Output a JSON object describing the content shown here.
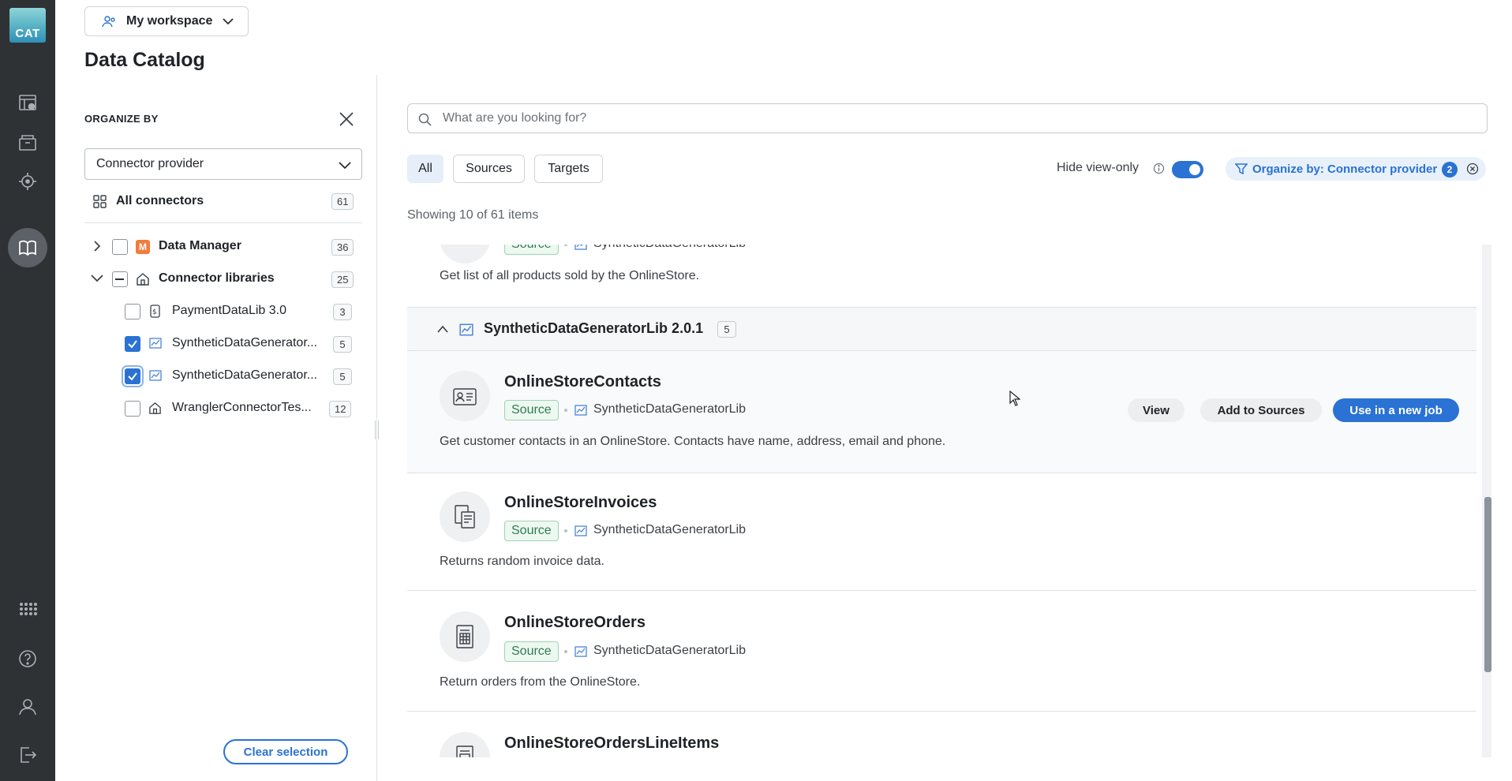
{
  "app": {
    "logo_text": "CAT"
  },
  "rail": {
    "items": [
      {
        "name": "jobs-icon"
      },
      {
        "name": "folder-icon"
      },
      {
        "name": "target-icon"
      },
      {
        "name": "catalog-book-icon",
        "active": true
      }
    ],
    "bottom": [
      {
        "name": "apps-grid-icon"
      },
      {
        "name": "help-icon"
      },
      {
        "name": "user-icon"
      },
      {
        "name": "logout-icon"
      }
    ]
  },
  "header": {
    "workspace": "My workspace",
    "title": "Data Catalog"
  },
  "organize": {
    "title": "ORGANIZE BY",
    "selected": "Connector provider",
    "all_label": "All connectors",
    "all_count": "61",
    "tree": [
      {
        "label": "Data Manager",
        "count": "36",
        "icon": "M"
      },
      {
        "label": "Connector libraries",
        "count": "25"
      },
      {
        "label": "PaymentDataLib 3.0",
        "count": "3"
      },
      {
        "label": "SyntheticDataGenerator...",
        "count": "5"
      },
      {
        "label": "SyntheticDataGenerator...",
        "count": "5"
      },
      {
        "label": "WranglerConnectorTes...",
        "count": "12"
      }
    ],
    "clear_label": "Clear selection"
  },
  "main": {
    "search_placeholder": "What are you looking for?",
    "filters": [
      "All",
      "Sources",
      "Targets"
    ],
    "hide_view_only": "Hide view-only",
    "hide_view_only_on": true,
    "org_chip": "Organize by: Connector provider",
    "org_chip_count": "2",
    "showing": "Showing 10 of 61 items",
    "top_item": {
      "badge": "Source",
      "lib": "SyntheticDataGeneratorLib",
      "desc": "Get list of all products sold by the OnlineStore."
    },
    "group": {
      "title": "SyntheticDataGeneratorLib 2.0.1",
      "count": "5"
    },
    "items": [
      {
        "title": "OnlineStoreContacts",
        "badge": "Source",
        "lib": "SyntheticDataGeneratorLib",
        "desc": "Get customer contacts in an OnlineStore. Contacts have name, address, email and phone."
      },
      {
        "title": "OnlineStoreInvoices",
        "badge": "Source",
        "lib": "SyntheticDataGeneratorLib",
        "desc": "Returns random invoice data."
      },
      {
        "title": "OnlineStoreOrders",
        "badge": "Source",
        "lib": "SyntheticDataGeneratorLib",
        "desc": "Return orders from the OnlineStore."
      },
      {
        "title": "OnlineStoreOrdersLineItems"
      }
    ],
    "actions": {
      "view": "View",
      "add": "Add to Sources",
      "use": "Use in a new job"
    }
  },
  "colors": {
    "accent": "#2a72d4",
    "rail": "#2e3235",
    "source_badge": "#2f7d4e"
  }
}
